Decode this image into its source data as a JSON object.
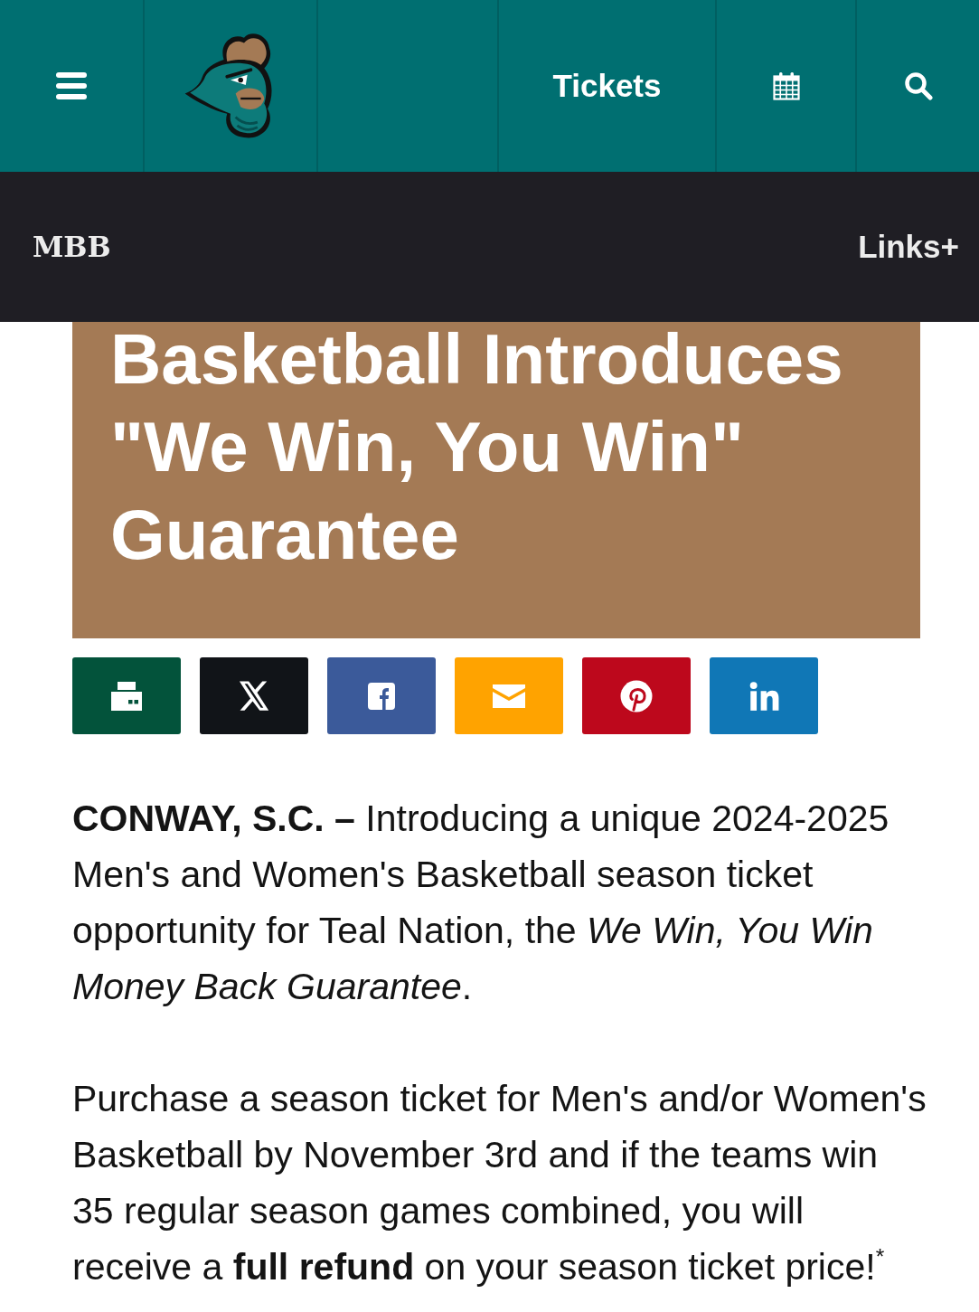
{
  "top_nav": {
    "items": [
      {
        "kind": "menu"
      },
      {
        "kind": "logo"
      },
      {
        "kind": "blank"
      },
      {
        "kind": "link",
        "label": "Tickets"
      },
      {
        "kind": "calendar"
      },
      {
        "kind": "search"
      }
    ]
  },
  "section_bar": {
    "title": "MBB",
    "links": "Links+"
  },
  "article": {
    "headline": "Basketball Introduces \"We Win, You Win\" Guarantee",
    "share_buttons": [
      {
        "kind": "print",
        "color": "#03533b"
      },
      {
        "kind": "x",
        "color": "#111418"
      },
      {
        "kind": "facebook",
        "color": "#3b5a9a"
      },
      {
        "kind": "email",
        "color": "#ffa300"
      },
      {
        "kind": "pinterest",
        "color": "#bd081c"
      },
      {
        "kind": "linkedin",
        "color": "#1077b6"
      }
    ],
    "paragraphs": [
      "**CONWAY, S.C. –** Introducing a unique 2024-2025 Men's and Women's Basketball season ticket opportunity for Teal Nation, the *We Win, You Win Money Back Guarantee*.",
      "Purchase a season ticket for Men's and/or Women's Basketball by November 3rd and if the teams win 35 regular season games combined, you will receive a **full refund** on your season ticket price!$^{*}$"
    ]
  }
}
